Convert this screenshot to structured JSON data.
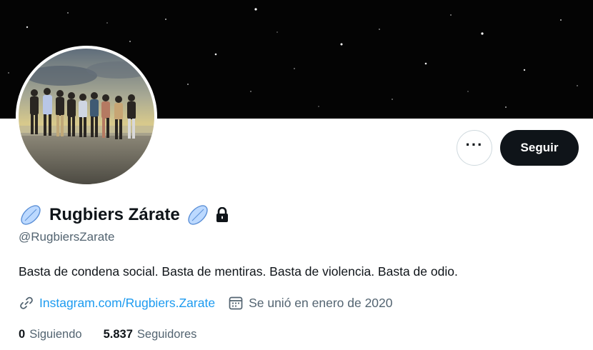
{
  "profile": {
    "display_name": "Rugbiers Zárate",
    "handle": "@RugbiersZarate",
    "bio": "Basta de condena social. Basta de mentiras. Basta de violencia. Basta de odio.",
    "website": "Instagram.com/Rugbiers.Zarate",
    "joined": "Se unió en enero de 2020",
    "protected": true,
    "name_emoji": "rugby-ball-icon"
  },
  "actions": {
    "more_label": "···",
    "follow_label": "Seguir"
  },
  "stats": {
    "following_count": "0",
    "following_label": "Siguiendo",
    "followers_count": "5.837",
    "followers_label": "Seguidores"
  },
  "colors": {
    "banner": "#040404",
    "text": "#0f1419",
    "secondary_text": "#536471",
    "link": "#1d9bf0",
    "follow_button": "#0f1419"
  }
}
